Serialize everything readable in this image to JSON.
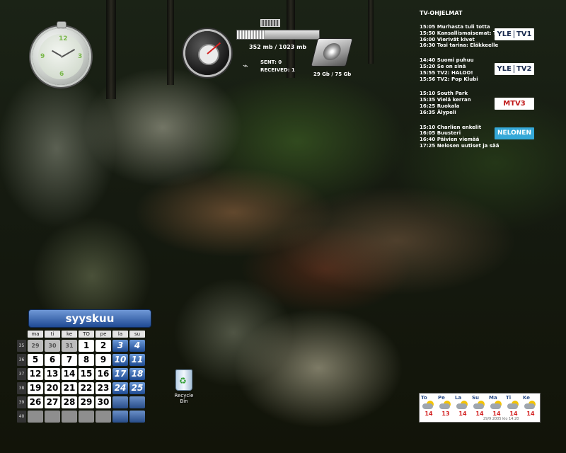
{
  "desktop": {
    "background": "forest-waterfall-wallpaper",
    "clock": {
      "numbers": [
        "12",
        "3",
        "6",
        "9"
      ],
      "time": "10:10"
    },
    "system_monitor": {
      "memory_text": "352 mb /  1023 mb",
      "memory_fraction": 0.34,
      "sent": "SENT: 0",
      "received": "RECEIVED: 1",
      "disk_text": "29 Gb / 75 Gb"
    }
  },
  "tv": {
    "title": "TV-OHJELMAT",
    "channels": [
      {
        "logo": [
          "YLE",
          "TV1"
        ],
        "programs": [
          "15:05 Murhasta tuli totta",
          "15:50 Kansallismaisemat: Tapiola",
          "16:00 Vierivät kivet",
          "16:30 Tosi tarina: Eläkkeelle"
        ]
      },
      {
        "logo": [
          "YLE",
          "TV2"
        ],
        "programs": [
          "14:40 Suomi puhuu",
          "15:20 Se on sinä",
          "15:55 TV2: HALOO!",
          "15:56 TV2: Pop Klubi"
        ]
      },
      {
        "logo": [
          "MTV3",
          ""
        ],
        "programs": [
          "15:10 South Park",
          "15:35 Vielä kerran",
          "16:25 Ruokala",
          "16:35 Älypeli"
        ]
      },
      {
        "logo": [
          "NELONEN",
          ""
        ],
        "programs": [
          "15:10 Charlien enkelit",
          "16:05 Buusteri",
          "16:40 Päivien viemää",
          "17:25 Nelosen uutiset ja sää"
        ]
      }
    ]
  },
  "calendar": {
    "month": "syyskuu",
    "weekdays": [
      "ma",
      "ti",
      "ke",
      "TO",
      "pe",
      "la",
      "su"
    ],
    "weeks": [
      "35",
      "36",
      "37",
      "38",
      "39",
      "40"
    ],
    "rows": [
      [
        "29",
        "30",
        "31",
        "1",
        "2",
        "3",
        "4"
      ],
      [
        "5",
        "6",
        "7",
        "8",
        "9",
        "10",
        "11"
      ],
      [
        "12",
        "13",
        "14",
        "15",
        "16",
        "17",
        "18"
      ],
      [
        "19",
        "20",
        "21",
        "22",
        "23",
        "24",
        "25"
      ],
      [
        "26",
        "27",
        "28",
        "29",
        "30",
        "",
        ""
      ],
      [
        "",
        "",
        "",
        "",
        "",
        "",
        ""
      ]
    ],
    "today": "29"
  },
  "recycle_bin": {
    "label": "Recycle Bin"
  },
  "weather": {
    "days": [
      {
        "day": "To",
        "temp": "14"
      },
      {
        "day": "Pe",
        "temp": "13"
      },
      {
        "day": "La",
        "temp": "14"
      },
      {
        "day": "Su",
        "temp": "14"
      },
      {
        "day": "Ma",
        "temp": "14"
      },
      {
        "day": "Ti",
        "temp": "14"
      },
      {
        "day": "Ke",
        "temp": "14"
      }
    ],
    "footer": "29/9 2005 klo 14:20"
  },
  "colors": {
    "accent": "#1f4a94",
    "weekend": "#3b6fbf",
    "temperature": "#d21d1d"
  }
}
